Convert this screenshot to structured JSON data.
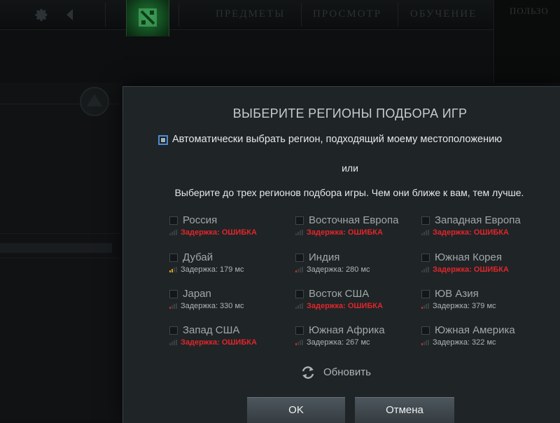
{
  "nav": {
    "tabs": [
      "ПРЕДМЕТЫ",
      "ПРОСМОТР",
      "ОБУЧЕНИЕ"
    ],
    "user": "ПОЛЬЗО"
  },
  "dialog": {
    "title": "ВЫБЕРИТЕ РЕГИОНЫ ПОДБОРА ИГР",
    "auto_label": "Автоматически выбрать регион, подходящий моему местоположению",
    "or": "или",
    "instruction": "Выберите до трех регионов подбора игры. Чем они ближе к вам, тем лучше.",
    "regions": [
      {
        "name": "Россия",
        "latency": "Задержка: ОШИБКА",
        "error": true,
        "signal": 0
      },
      {
        "name": "Восточная Европа",
        "latency": "Задержка: ОШИБКА",
        "error": true,
        "signal": 0
      },
      {
        "name": "Западная Европа",
        "latency": "Задержка: ОШИБКА",
        "error": true,
        "signal": 0
      },
      {
        "name": "Дубай",
        "latency": "Задержка: 179 мс",
        "error": false,
        "signal": 2
      },
      {
        "name": "Индия",
        "latency": "Задержка: 280 мс",
        "error": false,
        "signal": 1
      },
      {
        "name": "Южная Корея",
        "latency": "Задержка: ОШИБКА",
        "error": true,
        "signal": 0
      },
      {
        "name": "Japan",
        "latency": "Задержка: 330 мс",
        "error": false,
        "signal": 1
      },
      {
        "name": "Восток США",
        "latency": "Задержка: ОШИБКА",
        "error": true,
        "signal": 0
      },
      {
        "name": "ЮВ Азия",
        "latency": "Задержка: 379 мс",
        "error": false,
        "signal": 1
      },
      {
        "name": "Запад США",
        "latency": "Задержка: ОШИБКА",
        "error": true,
        "signal": 0
      },
      {
        "name": "Южная Африка",
        "latency": "Задержка: 267 мс",
        "error": false,
        "signal": 1
      },
      {
        "name": "Южная Америка",
        "latency": "Задержка: 322 мс",
        "error": false,
        "signal": 1
      }
    ],
    "refresh_label": "Обновить",
    "ok_label": "OK",
    "cancel_label": "Отмена"
  },
  "colors": {
    "error": "#e0262a",
    "signal_good": "#e0a020",
    "signal_weak": "#d02a2a",
    "signal_off": "#3a3f42",
    "accent_check": "#4f8bd2"
  }
}
